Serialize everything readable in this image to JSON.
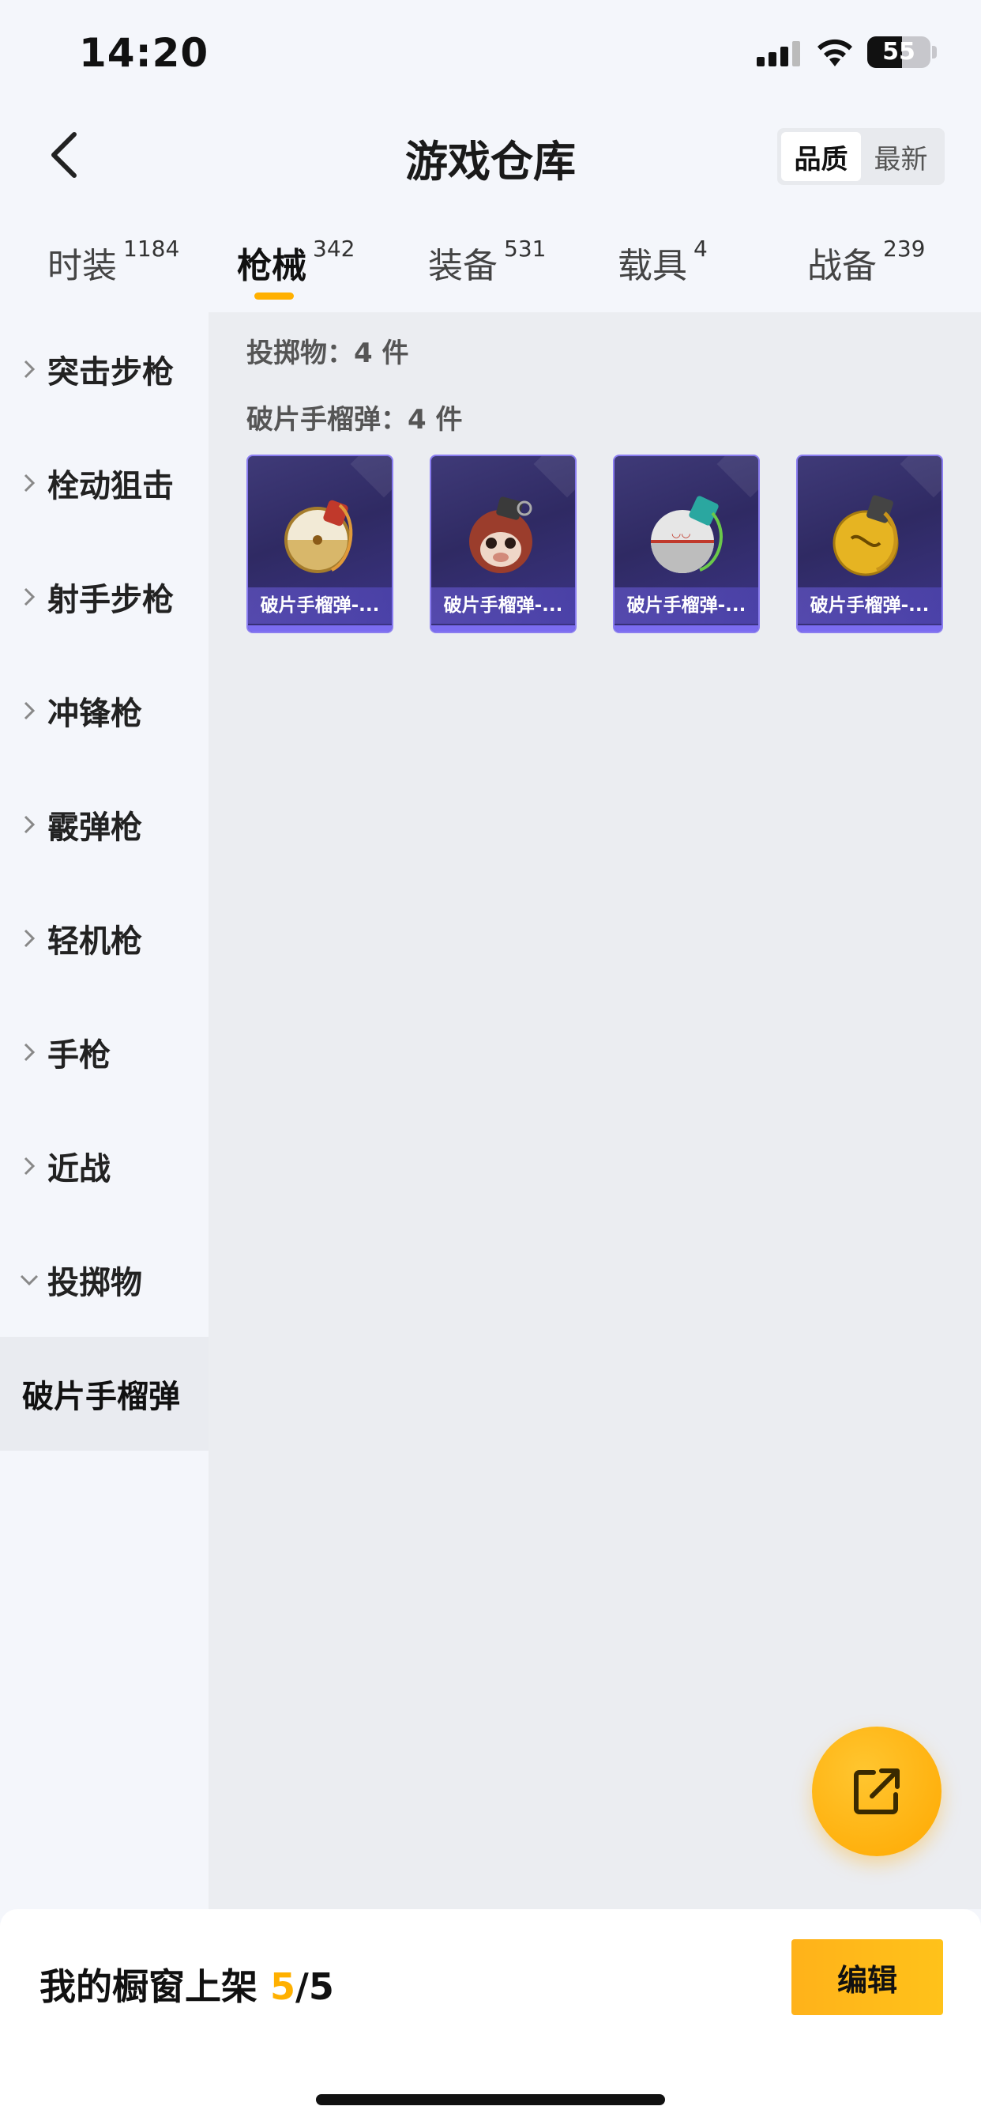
{
  "status_bar": {
    "time": "14:20",
    "battery_level": "55",
    "battery_percent": 55
  },
  "header": {
    "title": "游戏仓库",
    "sort_options": [
      {
        "label": "品质",
        "active": true
      },
      {
        "label": "最新",
        "active": false
      }
    ]
  },
  "tabs": [
    {
      "label": "时装",
      "count": "1184",
      "active": false
    },
    {
      "label": "枪械",
      "count": "342",
      "active": true
    },
    {
      "label": "装备",
      "count": "531",
      "active": false
    },
    {
      "label": "载具",
      "count": "4",
      "active": false
    },
    {
      "label": "战备",
      "count": "239",
      "active": false
    }
  ],
  "sidebar": {
    "items": [
      {
        "label": "突击步枪",
        "expanded": false
      },
      {
        "label": "栓动狙击",
        "expanded": false
      },
      {
        "label": "射手步枪",
        "expanded": false
      },
      {
        "label": "冲锋枪",
        "expanded": false
      },
      {
        "label": "霰弹枪",
        "expanded": false
      },
      {
        "label": "轻机枪",
        "expanded": false
      },
      {
        "label": "手枪",
        "expanded": false
      },
      {
        "label": "近战",
        "expanded": false
      },
      {
        "label": "投掷物",
        "expanded": true
      }
    ],
    "sub_item": {
      "label": "破片手榴弹"
    }
  },
  "content": {
    "category_summary": "投掷物：4 件",
    "subcategory_summary": "破片手榴弹：4 件",
    "items": [
      {
        "label": "破片手榴弹-..."
      },
      {
        "label": "破片手榴弹-..."
      },
      {
        "label": "破片手榴弹-..."
      },
      {
        "label": "破片手榴弹-..."
      }
    ]
  },
  "fab": {
    "icon": "share-icon"
  },
  "bottom_bar": {
    "showcase_label": "我的橱窗上架",
    "showcase_used": "5",
    "showcase_total": "/5",
    "edit_label": "编辑"
  },
  "colors": {
    "accent": "#ffb000",
    "card_bg": "#2f2a63",
    "card_border": "#8a7df0"
  }
}
